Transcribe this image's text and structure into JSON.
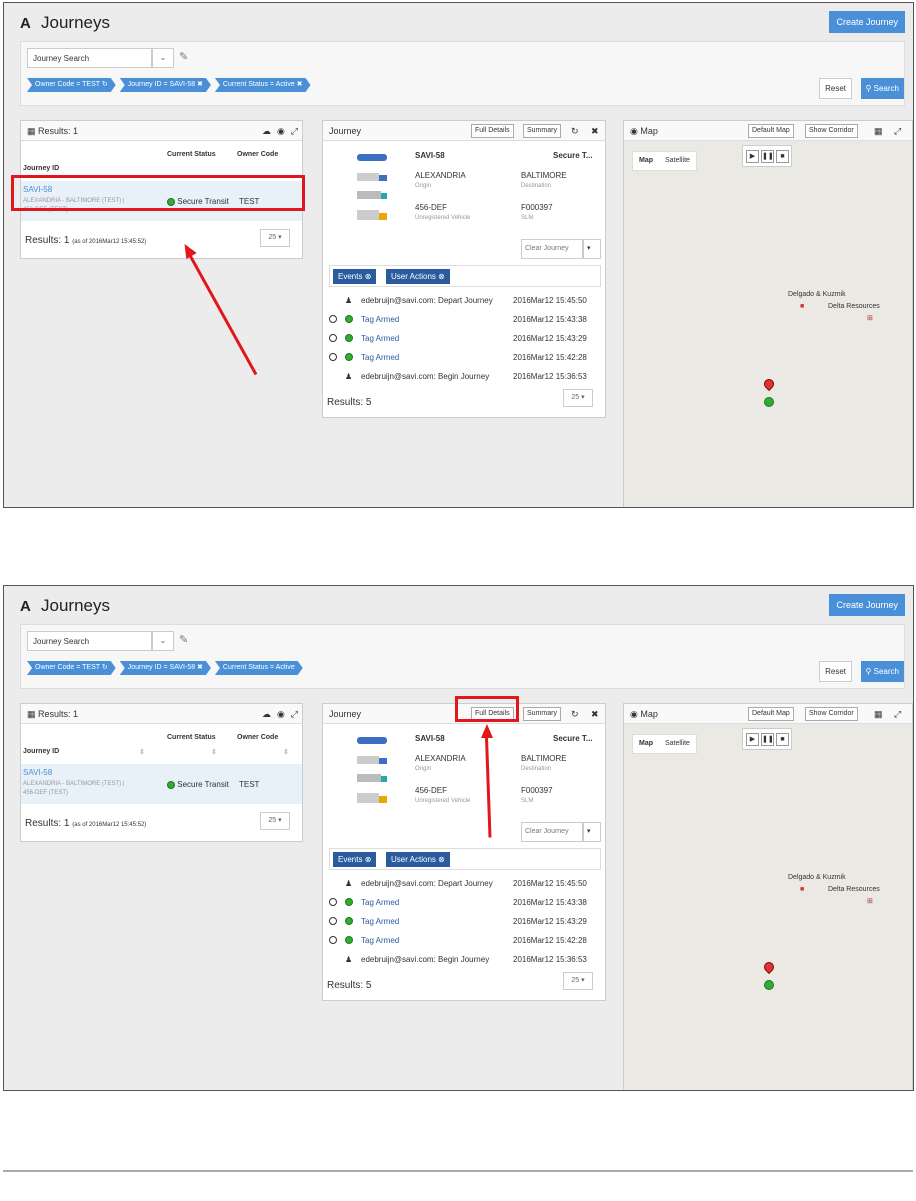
{
  "app": {
    "logo": "A",
    "title": "Journeys",
    "create_label": "Create Journey"
  },
  "search": {
    "select_value": "Journey Search",
    "chips": [
      "Owner Code = TEST",
      "Journey ID = SAVI-58",
      "Current Status = Active"
    ],
    "reset_label": "Reset",
    "search_label": "Search"
  },
  "results": {
    "title": "Results: 1",
    "col_status": "Current Status",
    "col_owner": "Owner Code",
    "col_id": "Journey ID",
    "row_id": "SAVI-58",
    "row_route": "ALEXANDRIA - BALTIMORE (TEST) |",
    "row_vehicle": "456-DEF (TEST)",
    "row_status": "Secure Transit",
    "row_owner": "TEST",
    "footer_count": "Results: 1",
    "footer_asof_1": "(as of 2016Mar12 15:45:52)",
    "footer_asof_2": "(as of 2016Mar12 15:45:52)",
    "pager": "25"
  },
  "journey": {
    "title": "Journey",
    "full_details": "Full Details",
    "summary": "Summary",
    "id": "SAVI-58",
    "status": "Secure T...",
    "origin": "ALEXANDRIA",
    "origin_label": "Origin",
    "destination": "BALTIMORE",
    "destination_label": "Destination",
    "vehicle": "456-DEF",
    "vehicle_label": "Unregistered Vehicle",
    "device": "F000397",
    "device_label": "SLM",
    "clear_label": "Clear Journey",
    "tab_events": "Events",
    "tab_user_actions": "User Actions",
    "events": [
      {
        "label": "edebruijn@savi.com: Depart Journey",
        "time": "2016Mar12 15:45:50",
        "kind": "user"
      },
      {
        "label": "Tag Armed",
        "time": "2016Mar12 15:43:38",
        "kind": "tag"
      },
      {
        "label": "Tag Armed",
        "time": "2016Mar12 15:43:29",
        "kind": "tag"
      },
      {
        "label": "Tag Armed",
        "time": "2016Mar12 15:42:28",
        "kind": "tag"
      },
      {
        "label": "edebruijn@savi.com: Begin Journey",
        "time": "2016Mar12 15:36:53",
        "kind": "user"
      }
    ],
    "footer": "Results: 5",
    "pager": "25"
  },
  "map": {
    "title": "Map",
    "default_map": "Default Map",
    "show_corridor": "Show Corridor",
    "tab_map": "Map",
    "tab_satellite": "Satellite",
    "poi_1": "Delgado & Kuzmik",
    "poi_2": "Delta Resources"
  },
  "colors": {
    "accent": "#4a90d9",
    "highlight": "#e0181c",
    "tab": "#2b5b9e"
  }
}
